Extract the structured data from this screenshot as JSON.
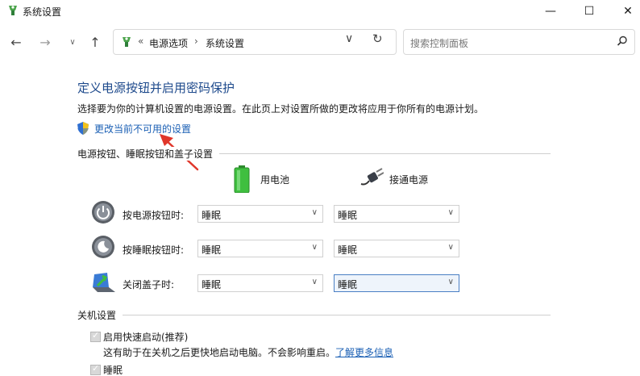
{
  "window": {
    "title": "系统设置",
    "minimize_glyph": "—",
    "maximize_glyph": "☐",
    "close_glyph": "✕"
  },
  "nav": {
    "back_glyph": "←",
    "forward_glyph": "→",
    "recent_glyph": "∨",
    "up_glyph": "↑",
    "address_sep": "«",
    "breadcrumb": [
      "电源选项",
      "系统设置"
    ],
    "crumb_chevron": "›",
    "dropdown_glyph": "∨",
    "refresh_glyph": "↻",
    "search_placeholder": "搜索控制面板"
  },
  "main": {
    "title": "定义电源按钮并启用密码保护",
    "description": "选择要为你的计算机设置的电源设置。在此页上对设置所做的更改将应用于你所有的电源计划。",
    "change_link": "更改当前不可用的设置",
    "power_section": {
      "title": "电源按钮、睡眠按钮和盖子设置",
      "col_battery": "用电池",
      "col_plugged": "接通电源",
      "rows": [
        {
          "label": "按电源按钮时:",
          "battery": "睡眠",
          "plugged": "睡眠"
        },
        {
          "label": "按睡眠按钮时:",
          "battery": "睡眠",
          "plugged": "睡眠"
        },
        {
          "label": "关闭盖子时:",
          "battery": "睡眠",
          "plugged": "睡眠"
        }
      ]
    },
    "shutdown_section": {
      "title": "关机设置",
      "fast_startup_label": "启用快速启动(推荐)",
      "fast_startup_desc": "这有助于在关机之后更快地启动电脑。不会影响重启。",
      "learn_more": "了解更多信息",
      "sleep_label": "睡眠"
    }
  },
  "colors": {
    "title_blue": "#1e4a8c",
    "link_blue": "#1a5fb4",
    "annotation_red": "#e0362a"
  }
}
